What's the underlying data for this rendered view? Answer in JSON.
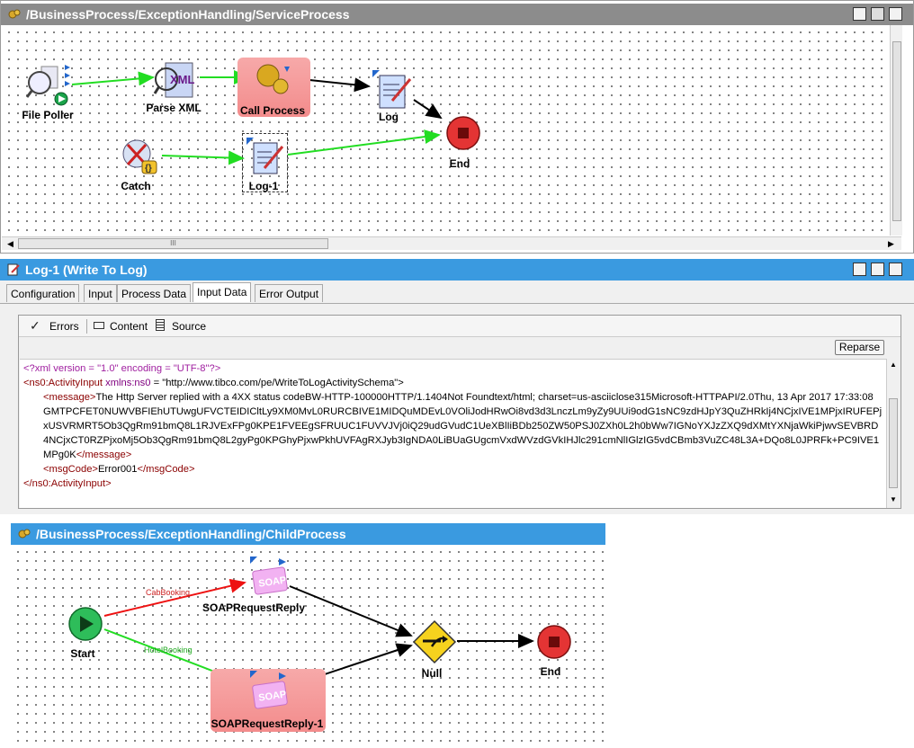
{
  "service_process": {
    "title": "/BusinessProcess/ExceptionHandling/ServiceProcess",
    "nodes": {
      "file_poller": "File Poller",
      "parse_xml": "Parse XML",
      "parse_xml_icon_text": "XML",
      "call_process": "Call Process",
      "log": "Log",
      "end": "End",
      "catch": "Catch",
      "log1": "Log-1"
    },
    "hscroll_grip": "III"
  },
  "log_panel": {
    "title": "Log-1 (Write To Log)",
    "tabs": [
      "Configuration",
      "Input",
      "Process Data",
      "Input Data",
      "Error Output"
    ],
    "active_tab": "Input Data",
    "toolbar": {
      "errors": "Errors",
      "content": "Content",
      "source": "Source"
    },
    "parse_button": "Reparse",
    "xml": {
      "decl": "<?xml version = \"1.0\" encoding = \"UTF-8\"?>",
      "root_open_tag": "<ns0:ActivityInput",
      "root_attr": " xmlns:ns0",
      "root_attr_value": " = \"http://www.tibco.com/pe/WriteToLogActivitySchema\">",
      "message_open": "<message>",
      "message_text": "The Http Server replied with a 4XX status codeBW-HTTP-100000HTTP/1.1404Not Foundtext/html; charset=us-asciiclose315Microsoft-HTTPAPI/2.0Thu, 13 Apr 2017 17:33:08 GMTPCFET0NUWVBFIEhUTUwgUFVCTEIDICltLy9XM0MvL0RURCBIVE1MIDQuMDEvL0VOliJodHRwOi8vd3d3LnczLm9yZy9UUi9odG1sNC9zdHJpY3QuZHRkIj4NCjxIVE1MPjxIRUFEPjxUSVRMRT5Ob3QgRm91bmQ8L1RJVExFPg0KPE1FVEEgSFRUUC1FUVVJVj0iQ29udGVudC1UeXBlIiBDb250ZW50PSJ0ZXh0L2h0bWw7IGNoYXJzZXQ9dXMtYXNjaWkiPjwvSEVBRD4NCjxCT0RZPjxoMj5Ob3QgRm91bmQ8L2gyPg0KPGhyPjxwPkhUVFAgRXJyb3IgNDA0LiBUaGUgcmVxdWVzdGVkIHJlc291cmNlIGlzIG5vdCBmb3VuZC48L3A+DQo8L0JPRFk+PC9IVE1MPg0K",
      "message_close": "</message>",
      "msgcode_open": "<msgCode>",
      "msgcode_text": "Error001",
      "msgcode_close": "</msgCode>",
      "root_close": "</ns0:ActivityInput>"
    }
  },
  "child_process": {
    "title": "/BusinessProcess/ExceptionHandling/ChildProcess",
    "nodes": {
      "start": "Start",
      "soap1": "SOAPRequestReply",
      "soap2": "SOAPRequestReply-1",
      "null": "Null",
      "end": "End",
      "soap_icon_text": "SOAP"
    },
    "transitions": {
      "cab": "CabBooking",
      "hotel": "HotelBooking"
    }
  },
  "colors": {
    "titlebar_active": "#3a9ae0",
    "titlebar_inactive": "#8c8c8c",
    "transition_green": "#22dd22",
    "transition_red": "#ee1111",
    "selected_highlight": "#f48a8a"
  }
}
